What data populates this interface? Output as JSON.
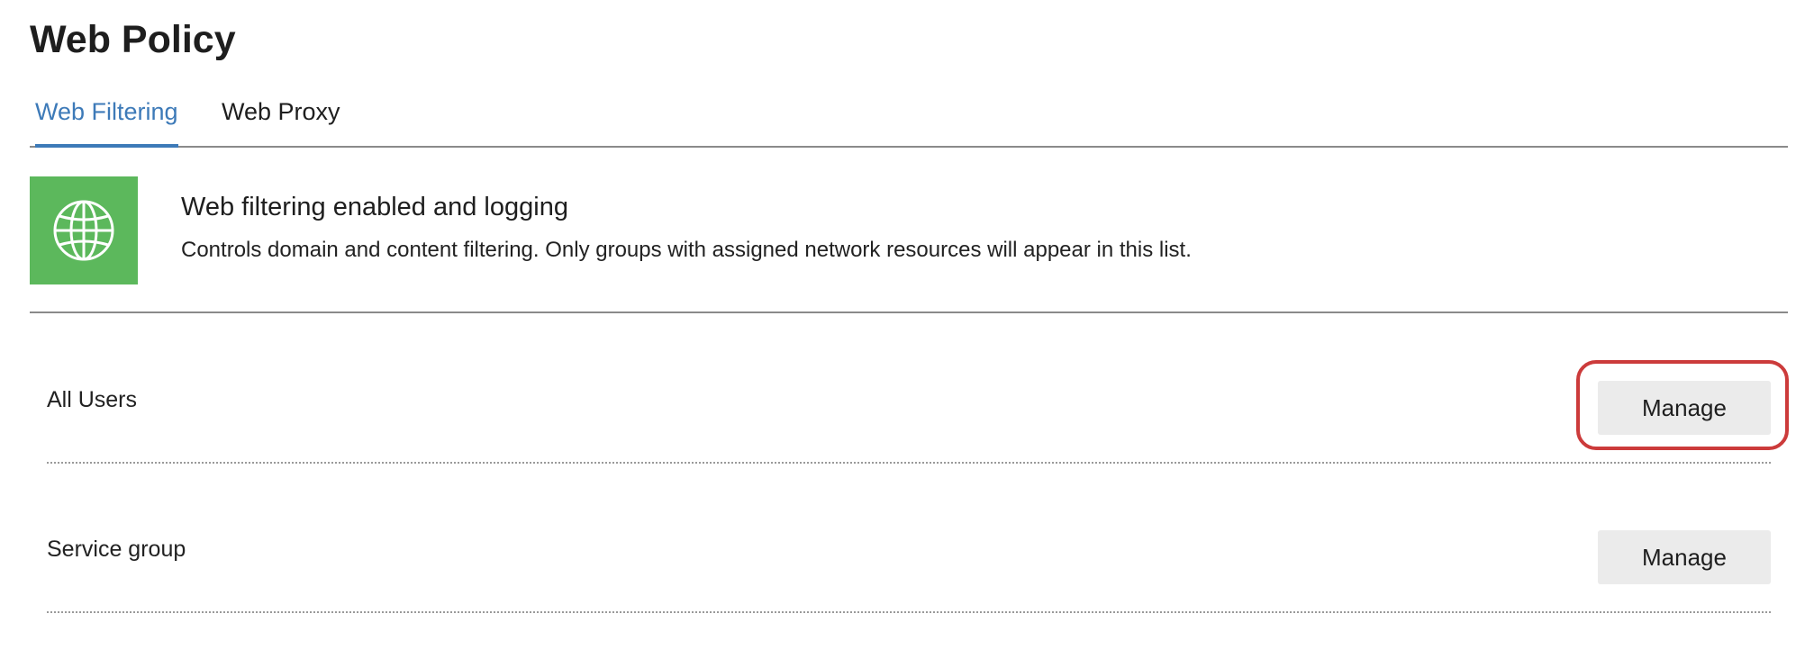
{
  "page": {
    "title": "Web Policy"
  },
  "tabs": [
    {
      "label": "Web Filtering",
      "active": true
    },
    {
      "label": "Web Proxy",
      "active": false
    }
  ],
  "status": {
    "icon": "globe-icon",
    "icon_bg_color": "#5cb85c",
    "title": "Web filtering enabled and logging",
    "description": "Controls domain and content filtering. Only groups with assigned network resources will appear in this list."
  },
  "groups": [
    {
      "name": "All Users",
      "action_label": "Manage",
      "highlighted": true
    },
    {
      "name": "Service group",
      "action_label": "Manage",
      "highlighted": false
    }
  ],
  "colors": {
    "accent": "#3d7ab8",
    "highlight": "#cc3b3b",
    "button_bg": "#ebebeb"
  }
}
